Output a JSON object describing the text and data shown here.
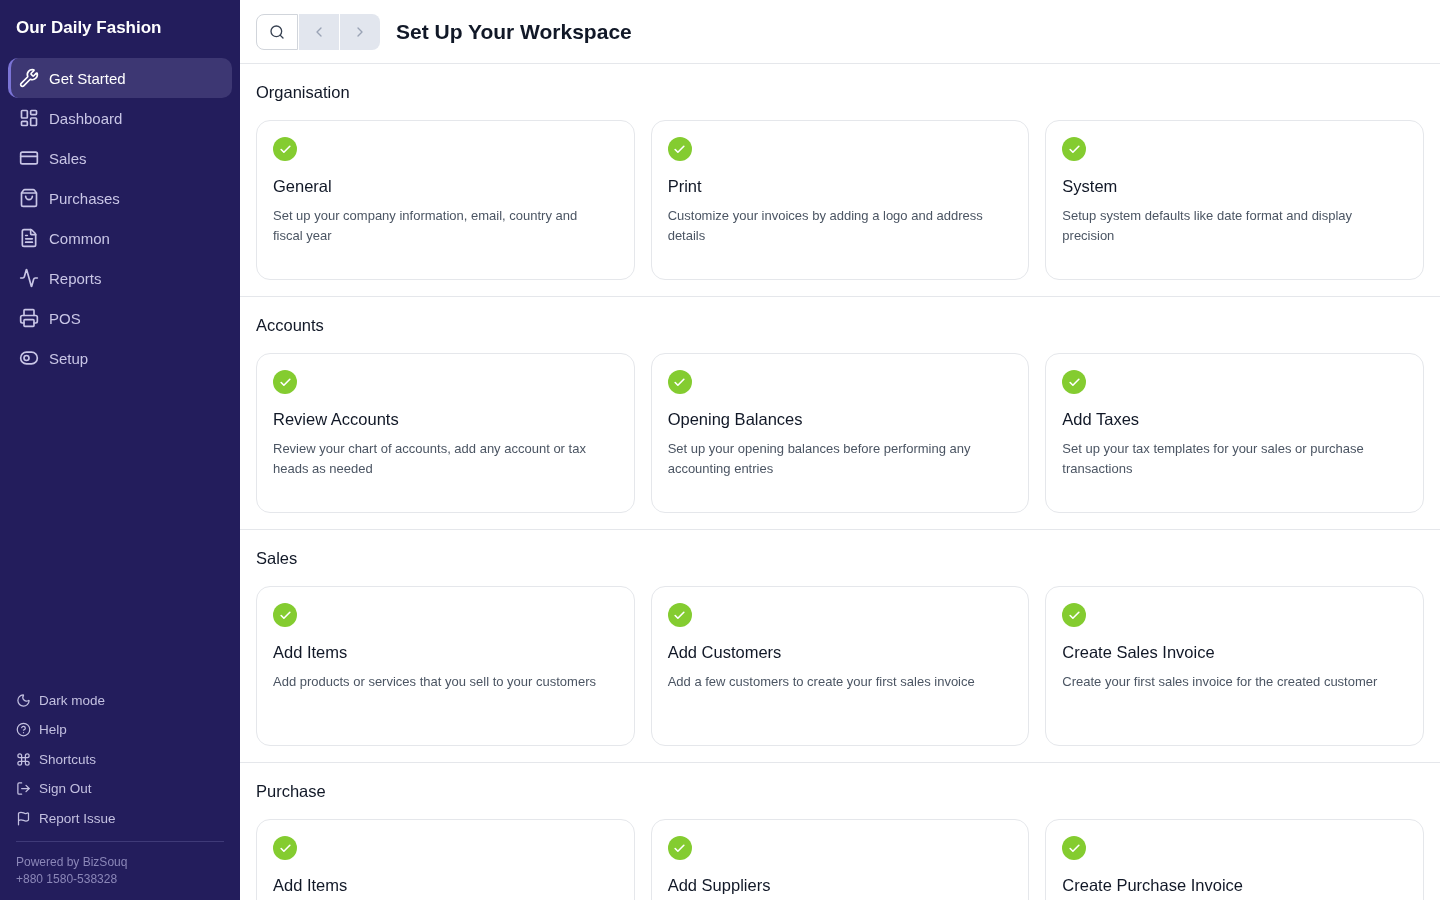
{
  "sidebar": {
    "title": "Our Daily Fashion",
    "items": [
      {
        "label": "Get Started",
        "selected": true
      },
      {
        "label": "Dashboard",
        "selected": false
      },
      {
        "label": "Sales",
        "selected": false
      },
      {
        "label": "Purchases",
        "selected": false
      },
      {
        "label": "Common",
        "selected": false
      },
      {
        "label": "Reports",
        "selected": false
      },
      {
        "label": "POS",
        "selected": false
      },
      {
        "label": "Setup",
        "selected": false
      }
    ],
    "footer_links": [
      "Dark mode",
      "Help",
      "Shortcuts",
      "Sign Out",
      "Report Issue"
    ],
    "powered_by": "Powered by BizSouq",
    "phone": "+880 1580-538328"
  },
  "header": {
    "title": "Set Up Your Workspace"
  },
  "sections": [
    {
      "title": "Organisation",
      "cards": [
        {
          "title": "General",
          "description": "Set up your company information, email, country and fiscal year",
          "done": true
        },
        {
          "title": "Print",
          "description": "Customize your invoices by adding a logo and address details",
          "done": true
        },
        {
          "title": "System",
          "description": "Setup system defaults like date format and display precision",
          "done": true
        }
      ]
    },
    {
      "title": "Accounts",
      "cards": [
        {
          "title": "Review Accounts",
          "description": "Review your chart of accounts, add any account or tax heads as needed",
          "done": true
        },
        {
          "title": "Opening Balances",
          "description": "Set up your opening balances before performing any accounting entries",
          "done": true
        },
        {
          "title": "Add Taxes",
          "description": "Set up your tax templates for your sales or purchase transactions",
          "done": true
        }
      ]
    },
    {
      "title": "Sales",
      "cards": [
        {
          "title": "Add Items",
          "description": "Add products or services that you sell to your customers",
          "done": true
        },
        {
          "title": "Add Customers",
          "description": "Add a few customers to create your first sales invoice",
          "done": true
        },
        {
          "title": "Create Sales Invoice",
          "description": "Create your first sales invoice for the created customer",
          "done": true
        }
      ]
    },
    {
      "title": "Purchase",
      "cards": [
        {
          "title": "Add Items",
          "done": true
        },
        {
          "title": "Add Suppliers",
          "done": true
        },
        {
          "title": "Create Purchase Invoice",
          "done": true
        }
      ]
    }
  ]
}
